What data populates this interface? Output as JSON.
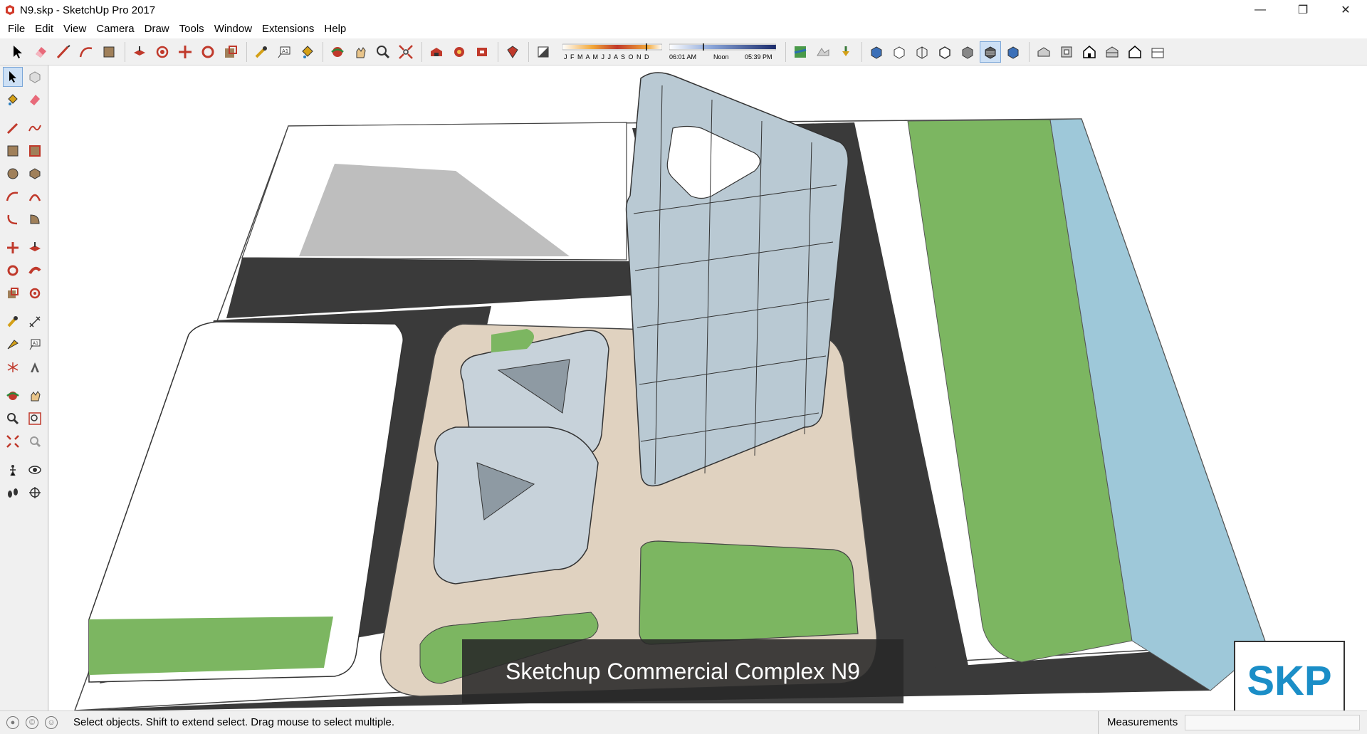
{
  "window": {
    "title": "N9.skp - SketchUp Pro 2017",
    "controls": [
      "minimize",
      "restore",
      "close"
    ]
  },
  "menu": [
    "File",
    "Edit",
    "View",
    "Camera",
    "Draw",
    "Tools",
    "Window",
    "Extensions",
    "Help"
  ],
  "toolbar": {
    "shadow_months": "J F M A M J J A S O N D",
    "time_start": "06:01 AM",
    "time_mid": "Noon",
    "time_end": "05:39 PM"
  },
  "viewport": {
    "caption": "Sketchup Commercial Complex N9",
    "logo": "SKP"
  },
  "status": {
    "hint": "Select objects. Shift to extend select. Drag mouse to select multiple.",
    "measurements_label": "Measurements",
    "measurements_value": ""
  },
  "colors": {
    "road": "#3a3a3a",
    "grass": "#7cb661",
    "water": "#9ec8d9",
    "plaza": "#e0d2c0",
    "glass": "#b9c9d3",
    "logo_blue": "#1b8ec7"
  }
}
